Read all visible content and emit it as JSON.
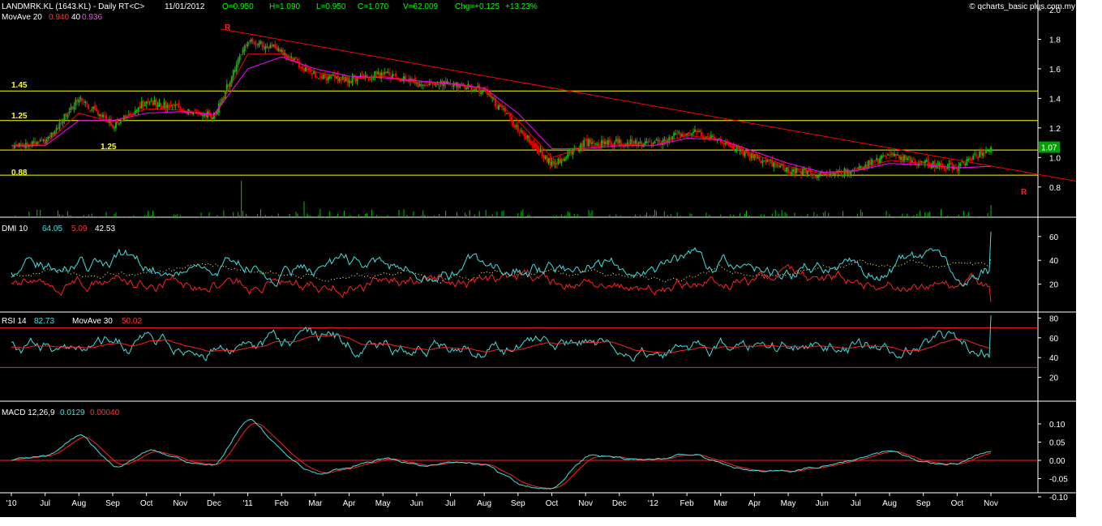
{
  "header": {
    "symbol": "LANDMRK.KL (1643.KL) - Daily RT<C>",
    "date": "11/01/2012",
    "open": "O=0.950",
    "high": "H=1.090",
    "low": "L=0.950",
    "close": "C=1.070",
    "volume": "V=62,009",
    "change": "Chg=+0.125",
    "change_pct": "+13.23%",
    "watermark": "© qcharts_basic plus.com.my",
    "mov_ave_label": "MovAve 20",
    "mov_ave_20": "0.940",
    "mov_ave_40_label": "40",
    "mov_ave_40": "0.936",
    "last_price_tag": "1.07"
  },
  "colors": {
    "background": "#000000",
    "up_candle": "#00c000",
    "down_candle": "#ff0000",
    "ma20": "#ff0000",
    "ma40": "#ff00ff",
    "level_line": "#ffff00",
    "trendline": "#ff0000",
    "volume": "#00c000",
    "cyan": "#40e0e0",
    "red": "#ff2020",
    "yellow_dotted": "#ffff80",
    "axis_text": "#ffffff",
    "price_tag": "#00a000"
  },
  "annotations": {
    "level_145": "1.45",
    "level_125": "1.25",
    "level_125b": "1.25",
    "level_088": "0.88",
    "r_top": "R",
    "r_bottom": "R"
  },
  "x_axis": {
    "labels": [
      "'10",
      "Jul",
      "Aug",
      "Sep",
      "Oct",
      "Nov",
      "Dec",
      "'11",
      "Feb",
      "Mar",
      "Apr",
      "May",
      "Jun",
      "Jul",
      "Aug",
      "Sep",
      "Oct",
      "Nov",
      "Dec",
      "'12",
      "Feb",
      "Mar",
      "Apr",
      "May",
      "Jun",
      "Jul",
      "Aug",
      "Sep",
      "Oct",
      "Nov"
    ]
  },
  "panels": {
    "price": {
      "y_ticks": [
        "2.0",
        "1.8",
        "1.6",
        "1.4",
        "1.2",
        "1.0",
        "0.8"
      ]
    },
    "dmi": {
      "label": "DMI 10",
      "v1": "64.05",
      "v2": "5.09",
      "v3": "42.53",
      "y_ticks": [
        "60",
        "40",
        "20"
      ]
    },
    "rsi": {
      "label": "RSI 14",
      "v1": "82.73",
      "ma_label": "MovAve 30",
      "v2": "50.02",
      "y_ticks": [
        "80",
        "60",
        "40",
        "20"
      ]
    },
    "macd": {
      "label": "MACD 12,26,9",
      "v1": "0.0129",
      "v2": "0.00040",
      "y_ticks": [
        "0.10",
        "0.05",
        "0.00",
        "-0.05",
        "-0.10"
      ]
    }
  },
  "chart_data": {
    "type": "line",
    "title": "LANDMRK.KL (1643.KL) - Daily RT<C>",
    "x": [
      "'10",
      "Jul",
      "Aug",
      "Sep",
      "Oct",
      "Nov",
      "Dec",
      "'11",
      "Feb",
      "Mar",
      "Apr",
      "May",
      "Jun",
      "Jul",
      "Aug",
      "Sep",
      "Oct",
      "Nov",
      "Dec",
      "'12",
      "Feb",
      "Mar",
      "Apr",
      "May",
      "Jun",
      "Jul",
      "Aug",
      "Sep",
      "Oct",
      "Nov"
    ],
    "ylim": [
      0.7,
      2.0
    ],
    "series": [
      {
        "name": "LANDMRK.KL (1643.KL)",
        "values": [
          1.08,
          1.1,
          1.4,
          1.22,
          1.38,
          1.33,
          1.28,
          1.8,
          1.72,
          1.55,
          1.52,
          1.57,
          1.5,
          1.5,
          1.45,
          1.2,
          0.95,
          1.1,
          1.1,
          1.09,
          1.18,
          1.12,
          1.0,
          0.92,
          0.88,
          0.92,
          1.02,
          0.96,
          0.93,
          1.07
        ]
      },
      {
        "name": "MovAve 20",
        "values": [
          1.08,
          1.09,
          1.3,
          1.24,
          1.33,
          1.32,
          1.28,
          1.7,
          1.7,
          1.58,
          1.53,
          1.55,
          1.51,
          1.5,
          1.46,
          1.25,
          1.0,
          1.07,
          1.09,
          1.08,
          1.15,
          1.12,
          1.02,
          0.94,
          0.89,
          0.91,
          0.98,
          0.96,
          0.93,
          0.94
        ]
      },
      {
        "name": "40",
        "values": [
          1.08,
          1.08,
          1.25,
          1.25,
          1.3,
          1.31,
          1.29,
          1.6,
          1.68,
          1.6,
          1.55,
          1.54,
          1.52,
          1.5,
          1.47,
          1.3,
          1.06,
          1.06,
          1.08,
          1.08,
          1.13,
          1.12,
          1.04,
          0.96,
          0.9,
          0.91,
          0.96,
          0.95,
          0.93,
          0.94
        ]
      }
    ],
    "horizontal_lines": [
      1.45,
      1.25,
      1.05,
      0.88
    ],
    "trendline": {
      "from": [
        "Dec",
        1.87
      ],
      "to": [
        "Nov",
        0.86
      ]
    },
    "grid": false
  }
}
